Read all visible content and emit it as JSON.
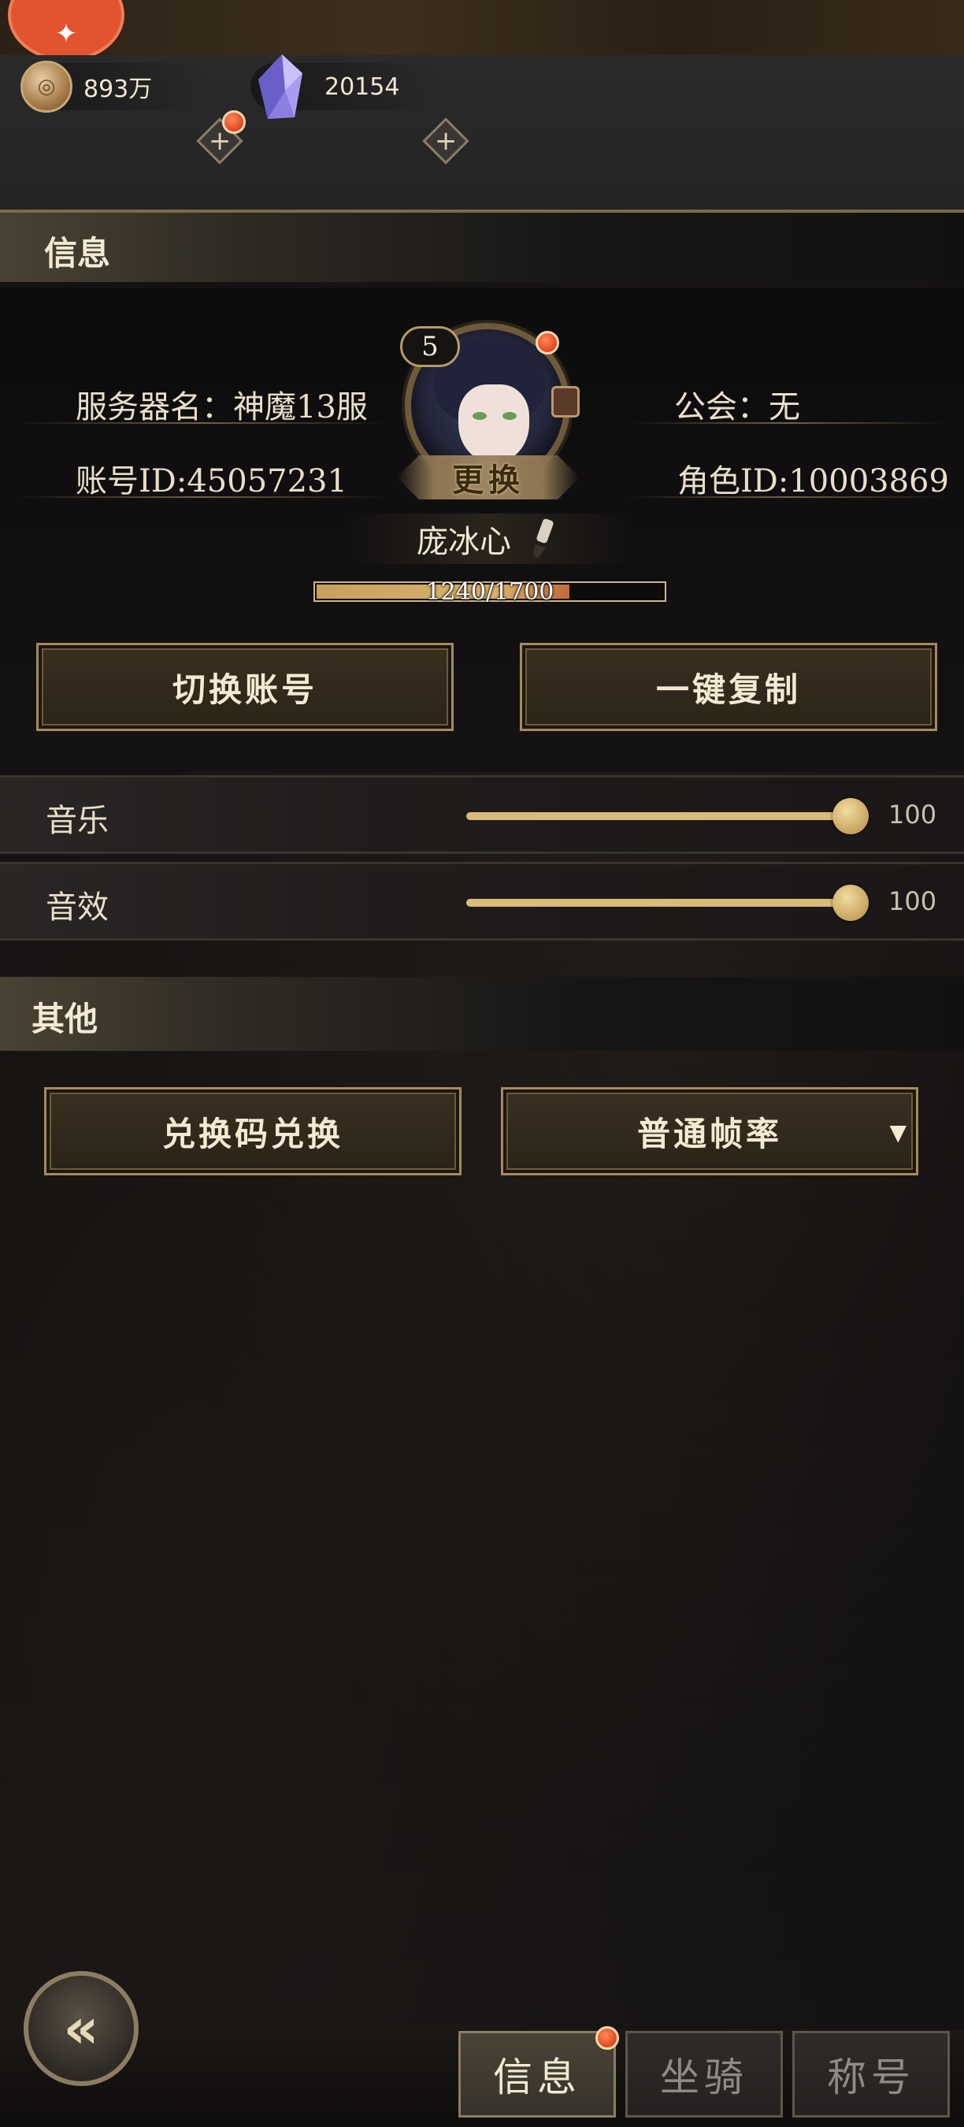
{
  "currency": {
    "coins": "893万",
    "crystals": "20154",
    "plus_symbol": "+"
  },
  "info_section": {
    "title": "信息",
    "server_name": "服务器名：神魔13服",
    "guild": "公会：无",
    "account_id": "账号ID:45057231",
    "role_id": "角色ID:10003869",
    "level": "5",
    "change_label": "更换",
    "player_name": "庞冰心",
    "exp_text": "1240/1700",
    "exp_fraction": 0.729,
    "switch_account_button": "切换账号",
    "copy_button": "一键复制"
  },
  "settings": {
    "music": {
      "label": "音乐",
      "value": "100",
      "level": 1.0
    },
    "sound": {
      "label": "音效",
      "value": "100",
      "level": 1.0
    }
  },
  "other_section": {
    "title": "其他",
    "redeem_button": "兑换码兑换",
    "frame_rate_selected": "普通帧率",
    "dropdown_arrow": "▼"
  },
  "bottom_tabs": [
    {
      "label": "信息",
      "active": true
    },
    {
      "label": "坐骑",
      "active": false
    },
    {
      "label": "称号",
      "active": false
    }
  ],
  "icons": {
    "gamepad": "gamepad-icon",
    "back": "back-arrow-icon",
    "coin": "coin-icon",
    "crystal": "crystal-icon",
    "edit": "brush-icon"
  },
  "back_symbol": "«",
  "colors": {
    "accent_gold": "#a58b5a",
    "notification_red": "#e2451f",
    "slider_gold": "#d8bd7a"
  }
}
